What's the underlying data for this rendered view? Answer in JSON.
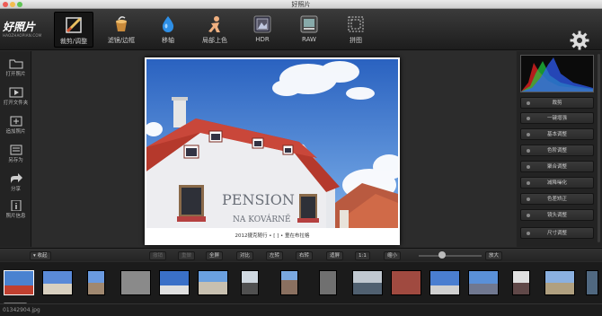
{
  "window": {
    "title": "好照片"
  },
  "logo": {
    "name": "好照片",
    "url": "HAOZHAOPIAN.COM"
  },
  "toolbar": {
    "tools": [
      {
        "label": "裁剪/调整",
        "icon": "crop-brush-icon",
        "active": true
      },
      {
        "label": "滤镜/边框",
        "icon": "filter-cup-icon"
      },
      {
        "label": "移轴",
        "icon": "droplet-icon"
      },
      {
        "label": "局部上色",
        "icon": "figure-color-icon"
      },
      {
        "label": "HDR",
        "icon": "hdr-icon"
      },
      {
        "label": "RAW",
        "icon": "raw-icon"
      },
      {
        "label": "拼图",
        "icon": "collage-icon"
      }
    ],
    "settings_icon": "gear-icon"
  },
  "sidebar": {
    "items": [
      {
        "label": "打开照片",
        "icon": "folder-icon"
      },
      {
        "label": "打开文件夹",
        "icon": "folder-play-icon"
      },
      {
        "label": "追加照片",
        "icon": "add-photo-icon"
      },
      {
        "label": "另存为",
        "icon": "save-as-icon"
      },
      {
        "label": "分享",
        "icon": "share-icon"
      },
      {
        "label": "照片信息",
        "icon": "info-icon"
      }
    ]
  },
  "photo": {
    "caption": "2012捷克随行 • [ ] • 童在布拉格",
    "sign_line1": "PENSION",
    "sign_line2": "NA KOVÁRNĚ"
  },
  "panel": {
    "histogram_colors": [
      "#e02020",
      "#20d040",
      "#3060ff"
    ],
    "items": [
      {
        "label": "裁剪"
      },
      {
        "label": "一键增强"
      },
      {
        "label": "基本调整"
      },
      {
        "label": "色阶调整"
      },
      {
        "label": "聚合调整"
      },
      {
        "label": "减降噪化"
      },
      {
        "label": "色差矫正"
      },
      {
        "label": "镜头调整"
      },
      {
        "label": "尺寸调整"
      }
    ]
  },
  "bottombar": {
    "collapse_label": "▾ 收起",
    "buttons": [
      {
        "label": "撤销",
        "enabled": false
      },
      {
        "label": "重做",
        "enabled": false
      },
      {
        "label": "全屏",
        "enabled": true
      },
      {
        "label": "对比",
        "enabled": true
      },
      {
        "label": "左转",
        "enabled": true
      },
      {
        "label": "右转",
        "enabled": true
      },
      {
        "label": "适屏",
        "enabled": true
      },
      {
        "label": "1:1",
        "enabled": true
      },
      {
        "label": "缩小",
        "enabled": true
      }
    ],
    "zoom_in_label": "放大",
    "zoom_level": 0.3
  },
  "filmstrip": {
    "count": 15,
    "selected_index": 0
  },
  "status": {
    "filename": "01342904.jpg"
  }
}
